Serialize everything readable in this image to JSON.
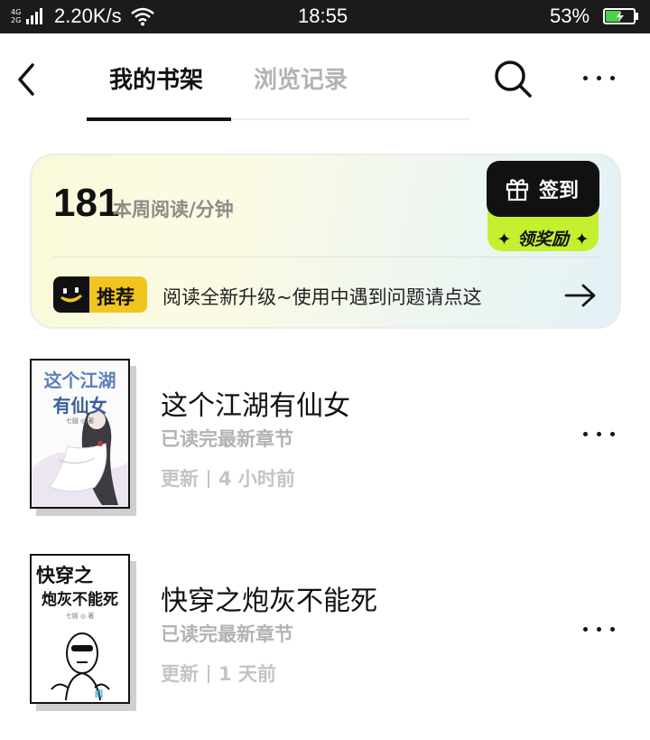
{
  "status_bar": {
    "network_top": "4G",
    "network_bottom": "2G",
    "speed": "2.20K/s",
    "time": "18:55",
    "battery_percent": "53%",
    "battery_level": 0.53
  },
  "header": {
    "tabs": [
      {
        "label": "我的书架",
        "active": true
      },
      {
        "label": "浏览记录",
        "active": false
      }
    ],
    "icons": {
      "back": "chevron-left-icon",
      "search": "search-icon",
      "more": "more-dots-icon"
    }
  },
  "reading_card": {
    "minutes": "181",
    "minutes_label": "本周阅读/分钟",
    "signin_label": "签到",
    "reward_label": "✦ 领奖励 ✦",
    "recommend_badge": "推荐",
    "recommend_text": "阅读全新升级~使用中遇到问题请点这"
  },
  "books": [
    {
      "cover_title_line1": "这个江湖",
      "cover_title_line2": "有仙女",
      "cover_author": "七翅 ◎ 著",
      "title": "这个江湖有仙女",
      "progress": "已读完最新章节",
      "update_label": "更新",
      "update_time": "4 小时前"
    },
    {
      "cover_title_line1": "快穿之",
      "cover_title_line2": "炮灰不能死",
      "cover_author": "七姬 ◎ 著",
      "title": "快穿之炮灰不能死",
      "progress": "已读完最新章节",
      "update_label": "更新",
      "update_time": "1 天前"
    }
  ],
  "colors": {
    "accent_black": "#111111",
    "reward_green": "#c4f02f",
    "badge_yellow": "#f1c51f",
    "muted_gray": "#b3b3b3"
  }
}
